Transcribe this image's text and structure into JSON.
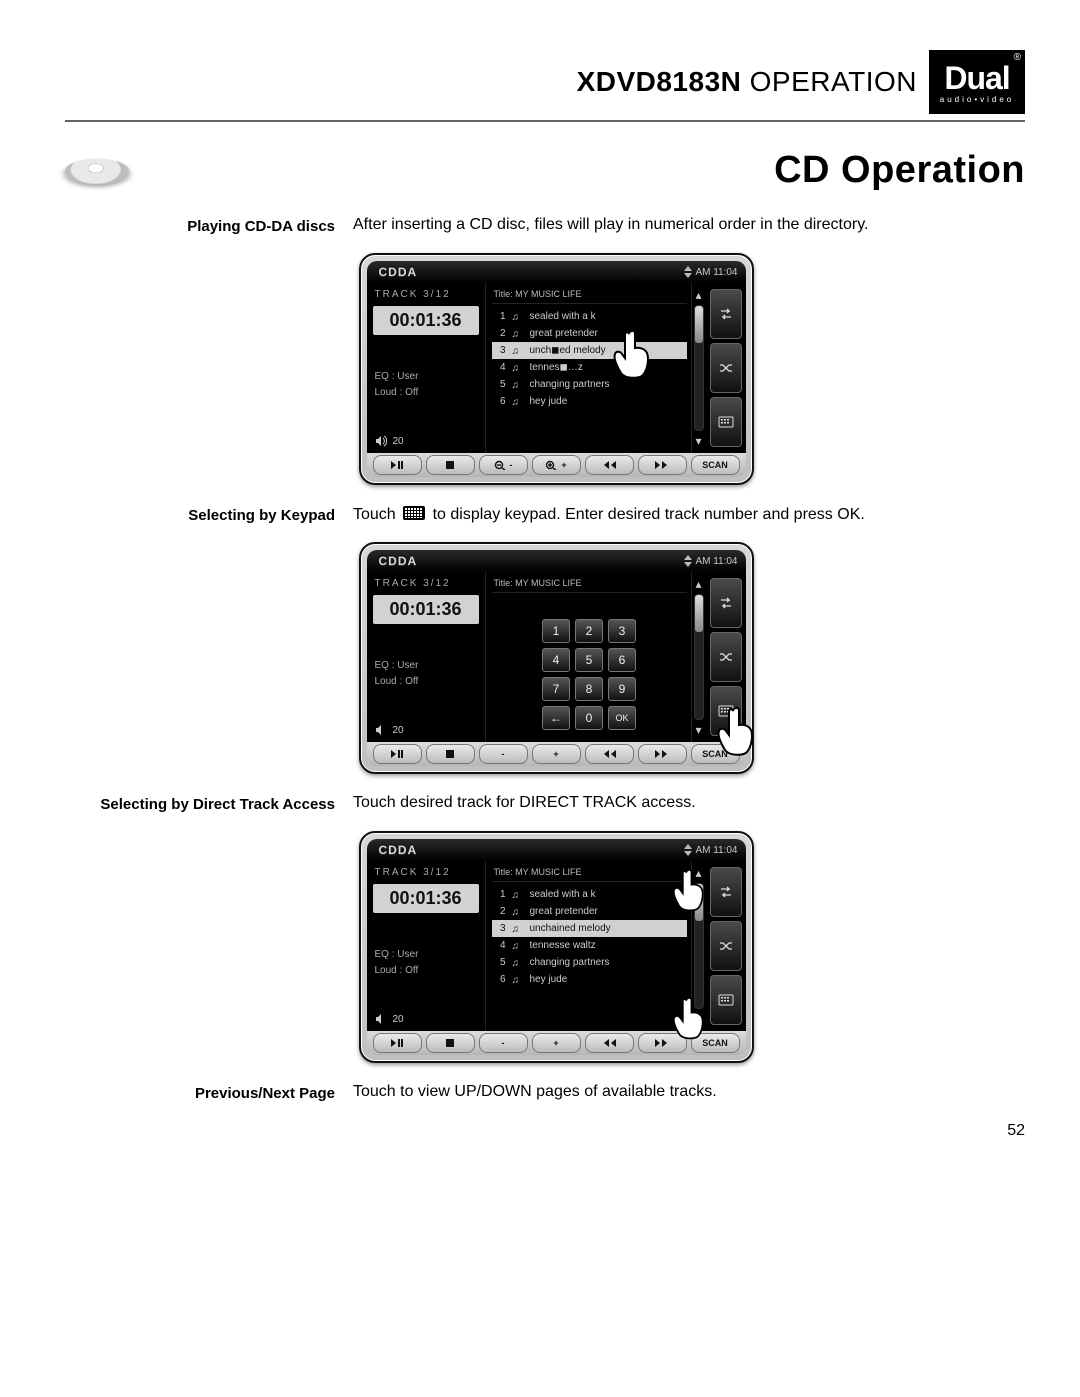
{
  "header": {
    "model": "XDVD8183N",
    "word": "OPERATION"
  },
  "logo": {
    "brand": "Dual",
    "sub": "audio•video",
    "reg": "®"
  },
  "section_title": "CD Operation",
  "rows": {
    "play": {
      "label": "Playing CD-DA discs",
      "text": "After inserting a CD disc, files will play in numerical order in the directory."
    },
    "keypad": {
      "label": "Selecting by Keypad",
      "before": "Touch ",
      "after": " to display keypad. Enter desired track number and press OK."
    },
    "direct": {
      "label": "Selecting by Direct Track Access",
      "text": "Touch desired track for DIRECT TRACK access."
    },
    "page": {
      "label": "Previous/Next Page",
      "text": "Touch to view UP/DOWN pages of available tracks."
    }
  },
  "device_common": {
    "mode": "CDDA",
    "clock": "AM 11:04",
    "track_label": "TRACK  3/12",
    "time": "00:01:36",
    "eq": "EQ  : User",
    "loud": "Loud : Off",
    "volume": "20",
    "title_bar": "Title: MY  MUSIC LIFE",
    "scan_label": "SCAN"
  },
  "tracks": [
    {
      "n": "1",
      "name": "sealed with a k"
    },
    {
      "n": "2",
      "name": "great pretender"
    },
    {
      "n": "3",
      "name": "unchained melody",
      "selected": true
    },
    {
      "n": "4",
      "name": "tennesse waltz"
    },
    {
      "n": "5",
      "name": "changing partners"
    },
    {
      "n": "6",
      "name": "hey jude"
    }
  ],
  "tracks_s1_overlay": {
    "3": "unch◼ed melody",
    "4": "tennes◼…z"
  },
  "keypad_keys": [
    "1",
    "2",
    "3",
    "4",
    "5",
    "6",
    "7",
    "8",
    "9",
    "←",
    "0",
    "OK"
  ],
  "page_number": "52"
}
